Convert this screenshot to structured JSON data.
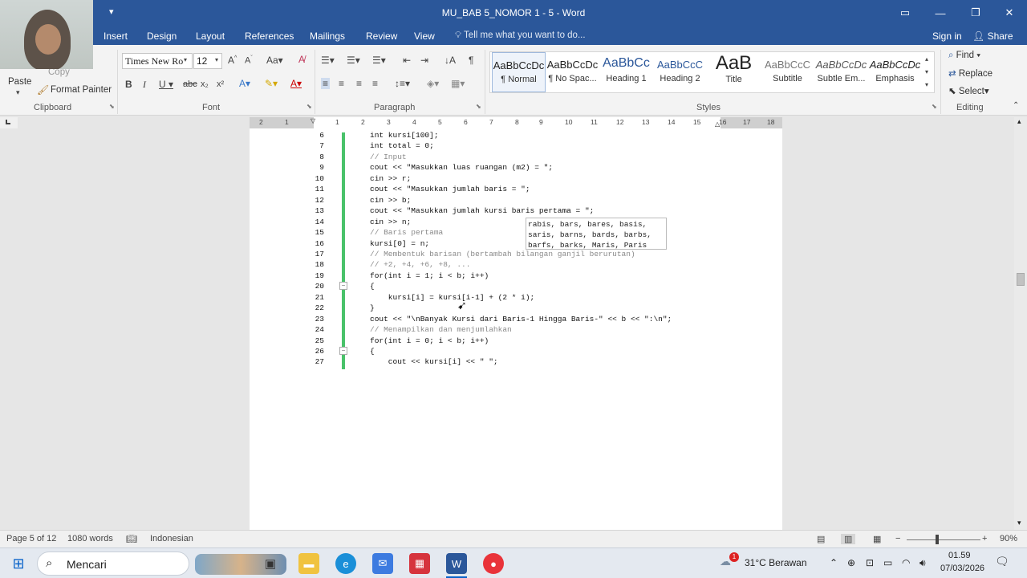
{
  "window": {
    "title": "MU_BAB 5_NOMOR 1 - 5 - Word",
    "quick_access_more": "▾"
  },
  "tabs": [
    "Insert",
    "Design",
    "Layout",
    "References",
    "Mailings",
    "Review",
    "View"
  ],
  "tell_me": "Tell me what you want to do...",
  "account": {
    "sign_in": "Sign in",
    "share": "Share"
  },
  "clipboard": {
    "copy": "Copy",
    "paste": "Paste",
    "format_painter": "Format Painter",
    "label": "Clipboard"
  },
  "font": {
    "name": "Times New Ro",
    "size": "12",
    "label": "Font"
  },
  "paragraph": {
    "label": "Paragraph"
  },
  "styles": {
    "label": "Styles",
    "items": [
      {
        "sample": "AaBbCcDc",
        "name": "¶ Normal"
      },
      {
        "sample": "AaBbCcDc",
        "name": "¶ No Spac..."
      },
      {
        "sample": "AaBbCc",
        "name": "Heading 1"
      },
      {
        "sample": "AaBbCcC",
        "name": "Heading 2"
      },
      {
        "sample": "AaB",
        "name": "Title"
      },
      {
        "sample": "AaBbCcC",
        "name": "Subtitle"
      },
      {
        "sample": "AaBbCcDc",
        "name": "Subtle Em..."
      },
      {
        "sample": "AaBbCcDc",
        "name": "Emphasis"
      }
    ]
  },
  "editing": {
    "find": "Find",
    "replace": "Replace",
    "select": "Select",
    "label": "Editing"
  },
  "ruler": {
    "numbers": [
      "2",
      "1",
      "1",
      "2",
      "3",
      "4",
      "5",
      "6",
      "7",
      "8",
      "9",
      "10",
      "11",
      "12",
      "13",
      "14",
      "15",
      "16",
      "17",
      "18"
    ]
  },
  "code_lines": [
    {
      "n": "6",
      "text": "int kursi[100];",
      "cmt": false
    },
    {
      "n": "7",
      "text": "int total = 0;",
      "cmt": false
    },
    {
      "n": "8",
      "text": "// Input",
      "cmt": true
    },
    {
      "n": "9",
      "text": "cout << \"Masukkan luas ruangan (m2) = \";",
      "cmt": false
    },
    {
      "n": "10",
      "text": "cin >> r;",
      "cmt": false
    },
    {
      "n": "11",
      "text": "cout << \"Masukkan jumlah baris = \";",
      "cmt": false
    },
    {
      "n": "12",
      "text": "cin >> b;",
      "cmt": false
    },
    {
      "n": "13",
      "text": "cout << \"Masukkan jumlah kursi baris pertama = \";",
      "cmt": false
    },
    {
      "n": "14",
      "text": "cin >> n;",
      "cmt": false
    },
    {
      "n": "15",
      "text": "// Baris pertama",
      "cmt": true
    },
    {
      "n": "16",
      "text": "kursi[0] = n;",
      "cmt": false
    },
    {
      "n": "17",
      "text": "// Membentuk barisan (bertambah bilangan ganjil berurutan)",
      "cmt": true
    },
    {
      "n": "18",
      "text": "// +2, +4, +6, +8, ...",
      "cmt": true
    },
    {
      "n": "19",
      "text": "for(int i = 1; i < b; i++)",
      "cmt": false
    },
    {
      "n": "20",
      "text": "{",
      "cmt": false
    },
    {
      "n": "21",
      "text": "    kursi[i] = kursi[i-1] + (2 * i);",
      "cmt": false
    },
    {
      "n": "22",
      "text": "}",
      "cmt": false
    },
    {
      "n": "23",
      "text": "cout << \"\\nBanyak Kursi dari Baris-1 Hingga Baris-\" << b << \":\\n\";",
      "cmt": false
    },
    {
      "n": "24",
      "text": "// Menampilkan dan menjumlahkan",
      "cmt": true
    },
    {
      "n": "25",
      "text": "for(int i = 0; i < b; i++)",
      "cmt": false
    },
    {
      "n": "26",
      "text": "{",
      "cmt": false
    },
    {
      "n": "27",
      "text": "    cout << kursi[i] << \" \";",
      "cmt": false
    }
  ],
  "spell_popup": [
    "rabis, bars, bares, basis,",
    "saris, barns, bards, barbs,",
    "barfs, barks, Maris, Paris"
  ],
  "status": {
    "page": "Page 5 of 12",
    "words": "1080 words",
    "language": "Indonesian",
    "zoom": "90%"
  },
  "taskbar": {
    "search": "Mencari",
    "weather": "31°C Berawan",
    "time": "01.59",
    "date": "07/03/2026",
    "notif_count": "1"
  }
}
